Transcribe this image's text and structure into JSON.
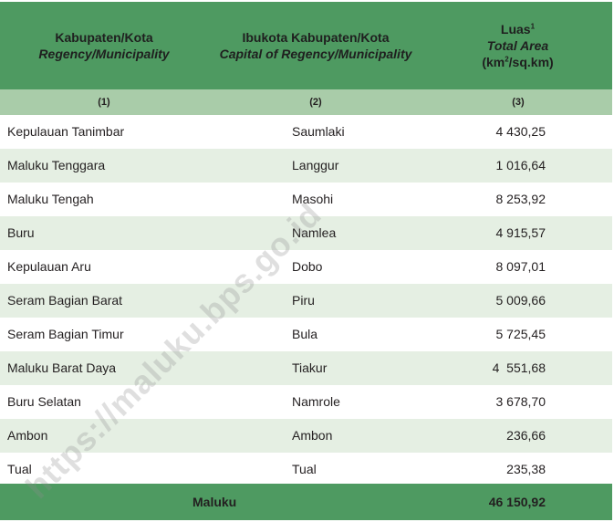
{
  "header": {
    "col1_id": "Kabupaten/Kota",
    "col1_en": "Regency/Municipality",
    "col2_id": "Ibukota Kabupaten/Kota",
    "col2_en": "Capital of Regency/Municipality",
    "col3_id": "Luas",
    "col3_sup": "1",
    "col3_en": "Total Area",
    "col3_unit_pre": "(km",
    "col3_unit_sup": "2",
    "col3_unit_post": "/sq.km)"
  },
  "col_numbers": [
    "(1)",
    "(2)",
    "(3)"
  ],
  "rows": [
    {
      "regency": "Kepulauan Tanimbar",
      "capital": "Saumlaki",
      "area": "4 430,25"
    },
    {
      "regency": "Maluku Tenggara",
      "capital": "Langgur",
      "area": "1 016,64"
    },
    {
      "regency": "Maluku Tengah",
      "capital": "Masohi",
      "area": "8 253,92"
    },
    {
      "regency": "Buru",
      "capital": "Namlea",
      "area": "4 915,57"
    },
    {
      "regency": "Kepulauan Aru",
      "capital": "Dobo",
      "area": "8 097,01"
    },
    {
      "regency": "Seram Bagian Barat",
      "capital": "Piru",
      "area": "5 009,66"
    },
    {
      "regency": "Seram Bagian Timur",
      "capital": "Bula",
      "area": "5 725,45"
    },
    {
      "regency": "Maluku Barat Daya",
      "capital": "Tiakur",
      "area": "4  551,68"
    },
    {
      "regency": "Buru Selatan",
      "capital": "Namrole",
      "area": "3 678,70"
    },
    {
      "regency": "Ambon",
      "capital": "Ambon",
      "area": "236,66"
    },
    {
      "regency": "Tual",
      "capital": "Tual",
      "area": "235,38"
    }
  ],
  "total": {
    "label": "Maluku",
    "value": "46 150,92"
  },
  "watermark": "https://maluku.bps.go.id",
  "colors": {
    "header_green": "#4e9a61",
    "subheader_green": "#a9cca9",
    "row_stripe": "#e5efe3"
  }
}
